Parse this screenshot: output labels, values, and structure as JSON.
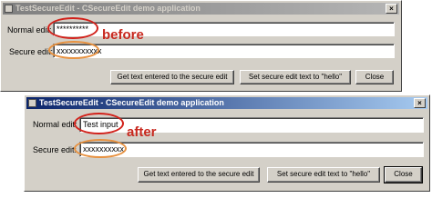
{
  "before": {
    "title": "TestSecureEdit - CSecureEdit demo application",
    "normal_label": "Normal edit:",
    "normal_value": "**********",
    "secure_label": "Secure edit:",
    "secure_value": "xxxxxxxxxxx",
    "btn_get": "Get text entered to the secure edit",
    "btn_set": "Set secure edit text to \"hello\"",
    "btn_close": "Close",
    "close_glyph": "×"
  },
  "after": {
    "title": "TestSecureEdit - CSecureEdit demo application",
    "normal_label": "Normal edit:",
    "normal_value": "Test input",
    "secure_label": "Secure edit:",
    "secure_value": "xxxxxxxxxx",
    "btn_get": "Get text entered to the secure edit",
    "btn_set": "Set secure edit text to \"hello\"",
    "btn_close": "Close",
    "close_glyph": "×"
  },
  "annotations": {
    "before_label": "before",
    "after_label": "after",
    "red": "#d2211a",
    "orange": "#e8913f"
  }
}
